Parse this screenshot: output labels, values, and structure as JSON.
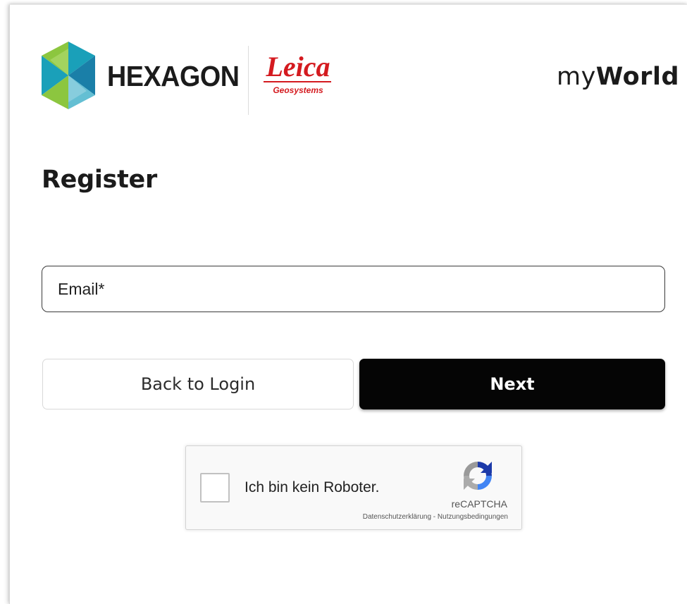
{
  "brand": {
    "hexagon_label": "HEXAGON",
    "leica_label": "Leica",
    "leica_sub": "Geosystems",
    "app_prefix": "my",
    "app_suffix": "World",
    "colors": {
      "hexagon_teal": "#1aa0b9",
      "hexagon_green": "#8cc63f",
      "leica_red": "#d41a1f"
    }
  },
  "page": {
    "title": "Register"
  },
  "form": {
    "email_placeholder": "Email*",
    "email_value": ""
  },
  "buttons": {
    "back_label": "Back to Login",
    "next_label": "Next"
  },
  "recaptcha": {
    "checkbox_label": "Ich bin kein Roboter.",
    "brand_label": "reCAPTCHA",
    "privacy_label": "Datenschutzerklärung",
    "separator": " - ",
    "terms_label": "Nutzungsbedingungen"
  }
}
